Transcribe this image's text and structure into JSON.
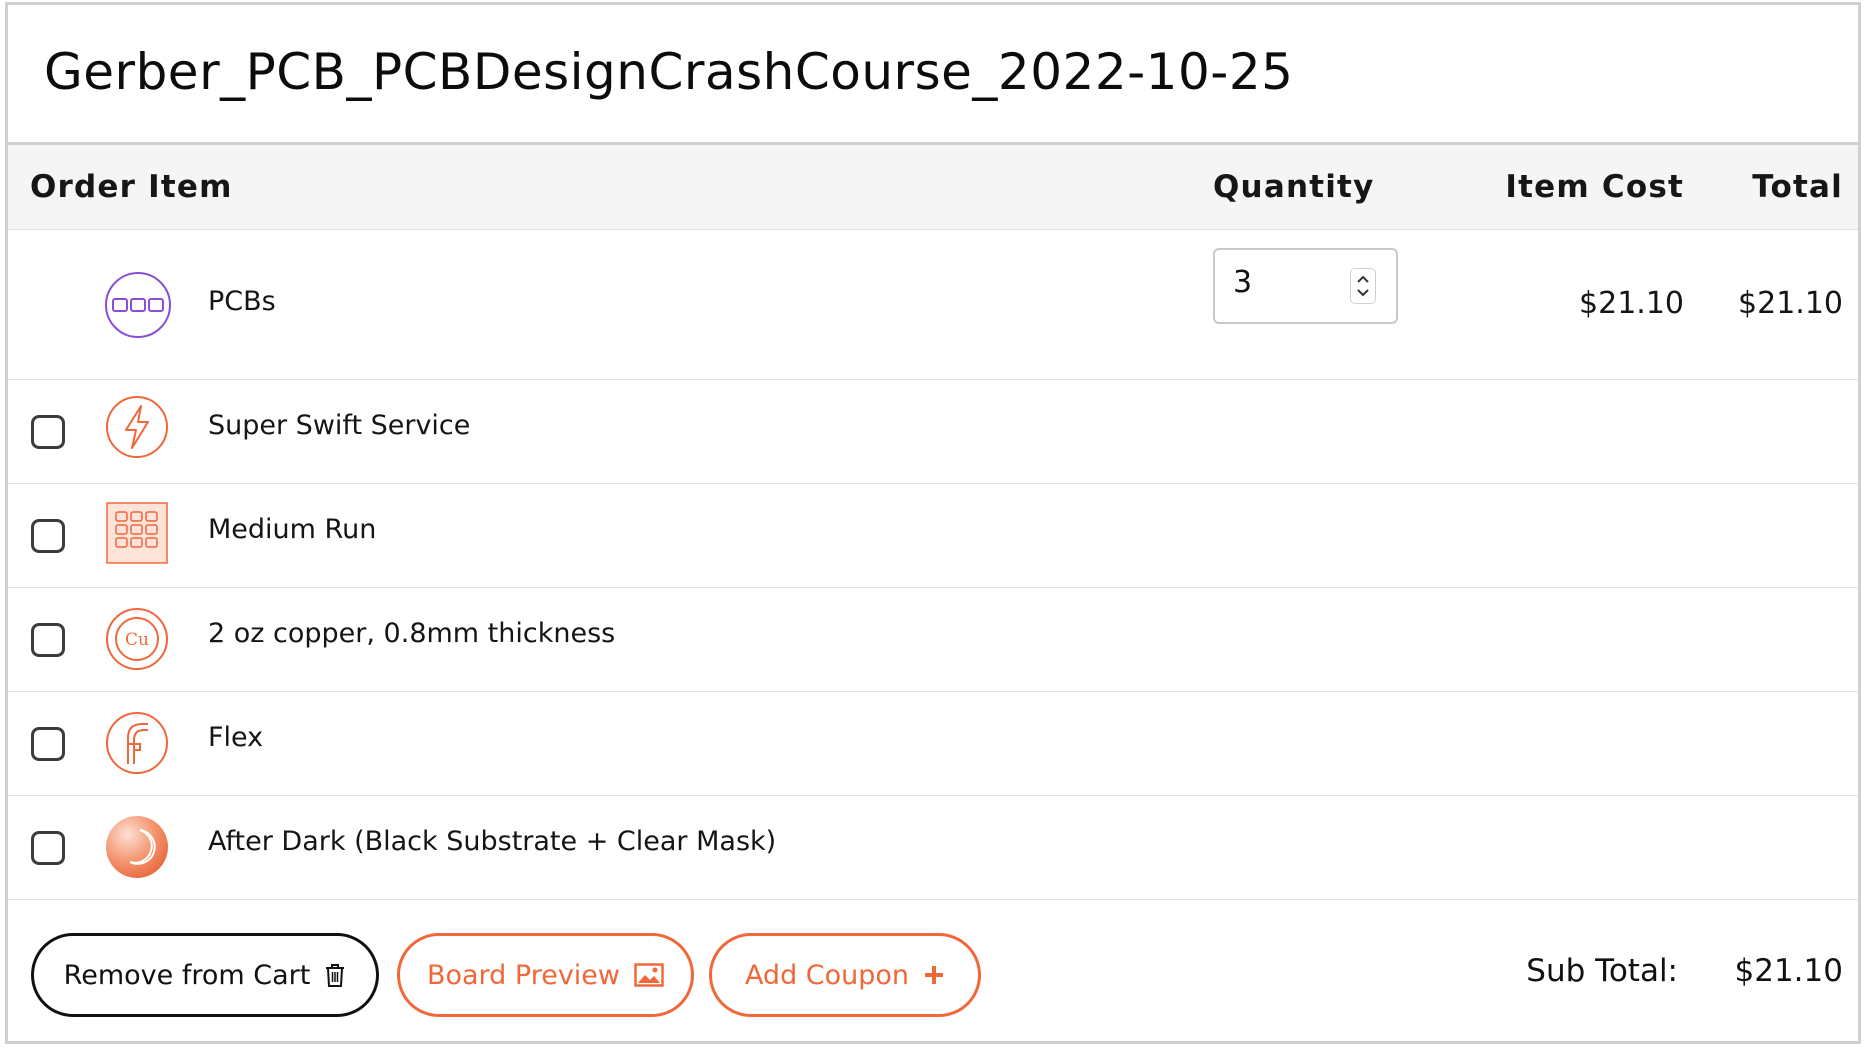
{
  "page_title": "Gerber_PCB_PCBDesignCrashCourse_2022-10-25",
  "columns": {
    "order_item": "Order Item",
    "quantity": "Quantity",
    "item_cost": "Item Cost",
    "total": "Total"
  },
  "main_item": {
    "label": "PCBs",
    "quantity": "3",
    "item_cost": "$21.10",
    "total": "$21.10",
    "icon": "pcb-panel-icon"
  },
  "options": [
    {
      "label": "Super Swift Service",
      "icon": "lightning-icon",
      "checked": false
    },
    {
      "label": "Medium Run",
      "icon": "grid-panel-icon",
      "checked": false
    },
    {
      "label": "2 oz copper, 0.8mm thickness",
      "icon": "copper-icon",
      "checked": false
    },
    {
      "label": "Flex",
      "icon": "flex-icon",
      "checked": false
    },
    {
      "label": "After Dark (Black Substrate + Clear Mask)",
      "icon": "moon-icon",
      "checked": false
    }
  ],
  "buttons": {
    "remove": "Remove from Cart",
    "preview": "Board Preview",
    "coupon": "Add Coupon"
  },
  "subtotal": {
    "label": "Sub Total:",
    "value": "$21.10"
  },
  "colors": {
    "accent": "#f0683a",
    "pcb_purple": "#8a4fd6",
    "border": "#d0d0d0"
  }
}
